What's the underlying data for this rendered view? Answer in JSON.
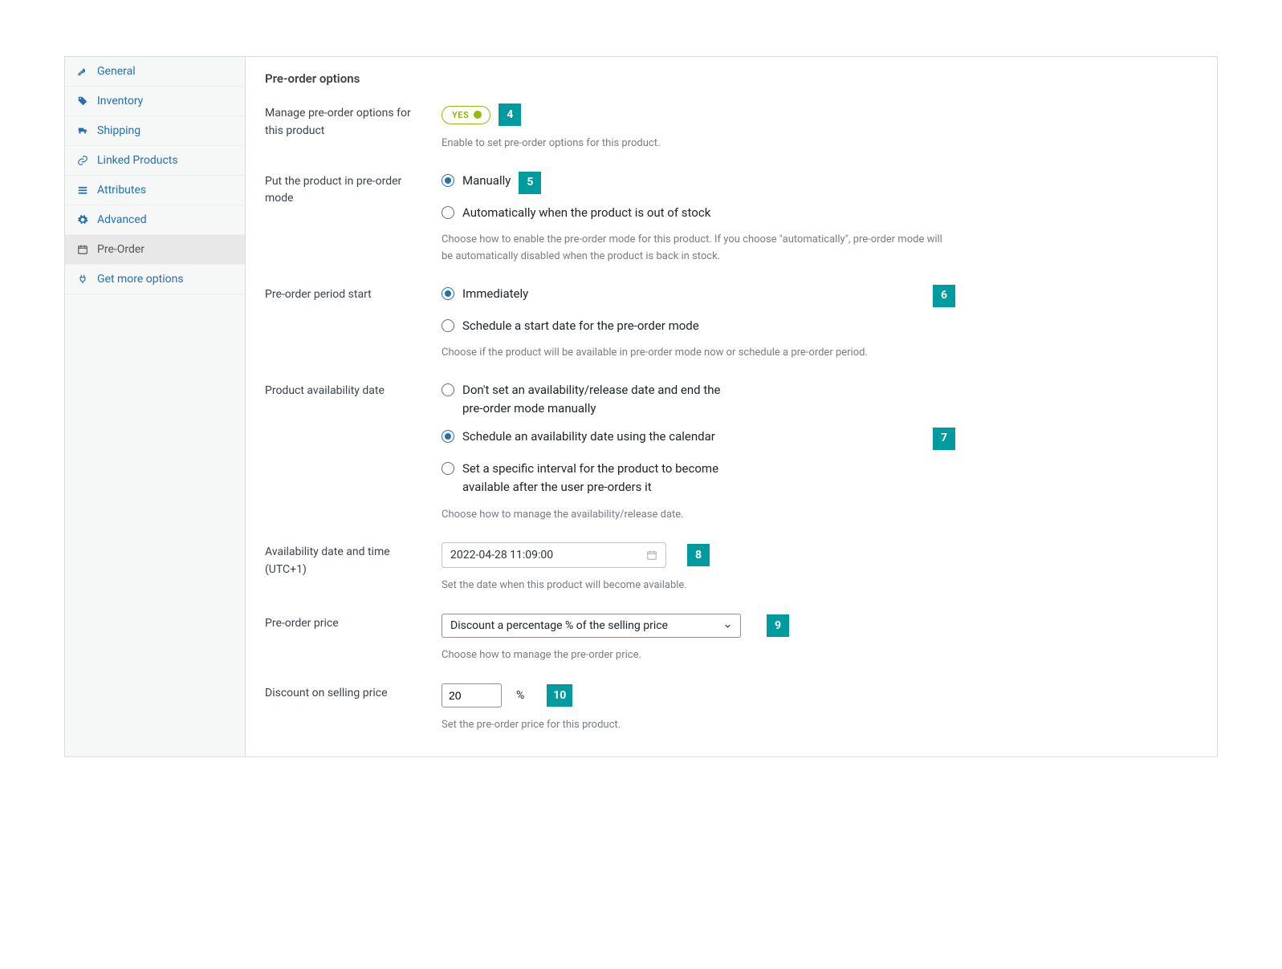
{
  "sidebar": [
    {
      "label": "General"
    },
    {
      "label": "Inventory"
    },
    {
      "label": "Shipping"
    },
    {
      "label": "Linked Products"
    },
    {
      "label": "Attributes"
    },
    {
      "label": "Advanced"
    },
    {
      "label": "Pre-Order"
    },
    {
      "label": "Get more options"
    }
  ],
  "title": "Pre-order options",
  "tags": {
    "t4": "4",
    "t5": "5",
    "t6": "6",
    "t7": "7",
    "t8": "8",
    "t9": "9",
    "t10": "10"
  },
  "sections": {
    "manage": {
      "label": "Manage pre-order options for this product",
      "toggleState": "YES",
      "help": "Enable to set pre-order options for this product."
    },
    "mode": {
      "label": "Put the product in pre-order mode",
      "options": [
        "Manually",
        "Automatically when the product is out of stock"
      ],
      "help": "Choose how to enable the pre-order mode for this product. If you choose \"automatically\", pre-order mode will be automatically disabled when the product is back in stock."
    },
    "periodStart": {
      "label": "Pre-order period start",
      "options": [
        "Immediately",
        "Schedule a start date for the pre-order mode"
      ],
      "help": "Choose if the product will be available in pre-order mode now or schedule a pre-order period."
    },
    "availDate": {
      "label": "Product availability date",
      "options": [
        "Don't set an availability/release date and end the pre-order mode manually",
        "Schedule an availability date using the calendar",
        "Set a specific interval for the product to become available after the user pre-orders it"
      ],
      "help": "Choose how to manage the availability/release date."
    },
    "availDateTime": {
      "label": "Availability date and time (UTC+1)",
      "value": "2022-04-28 11:09:00",
      "help": "Set the date when this product will become available."
    },
    "price": {
      "label": "Pre-order price",
      "selected": "Discount a percentage % of the selling price",
      "help": "Choose how to manage the pre-order price."
    },
    "discount": {
      "label": "Discount on selling price",
      "value": "20",
      "suffix": "%",
      "help": "Set the pre-order price for this product."
    }
  }
}
